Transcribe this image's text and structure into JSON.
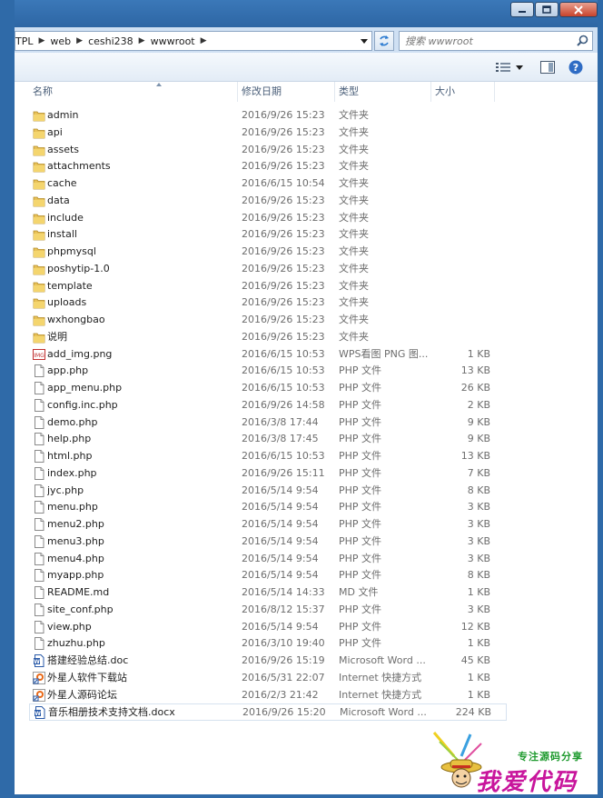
{
  "window": {
    "controls": {
      "minimize": "minimize",
      "maximize": "maximize",
      "close": "close"
    }
  },
  "address": {
    "crumbs": [
      "TPL",
      "web",
      "ceshi238",
      "wwwroot"
    ]
  },
  "search": {
    "placeholder": "搜索 wwwroot"
  },
  "toolbar": {
    "icons": [
      "view-details-icon",
      "view-options-dropdown-icon",
      "preview-pane-icon",
      "help-icon"
    ]
  },
  "columns": {
    "name": "名称",
    "date": "修改日期",
    "type": "类型",
    "size": "大小"
  },
  "files": [
    {
      "icon": "folder",
      "name": "admin",
      "date": "2016/9/26 15:23",
      "type": "文件夹",
      "size": ""
    },
    {
      "icon": "folder",
      "name": "api",
      "date": "2016/9/26 15:23",
      "type": "文件夹",
      "size": ""
    },
    {
      "icon": "folder",
      "name": "assets",
      "date": "2016/9/26 15:23",
      "type": "文件夹",
      "size": ""
    },
    {
      "icon": "folder",
      "name": "attachments",
      "date": "2016/9/26 15:23",
      "type": "文件夹",
      "size": ""
    },
    {
      "icon": "folder",
      "name": "cache",
      "date": "2016/6/15 10:54",
      "type": "文件夹",
      "size": ""
    },
    {
      "icon": "folder",
      "name": "data",
      "date": "2016/9/26 15:23",
      "type": "文件夹",
      "size": ""
    },
    {
      "icon": "folder",
      "name": "include",
      "date": "2016/9/26 15:23",
      "type": "文件夹",
      "size": ""
    },
    {
      "icon": "folder",
      "name": "install",
      "date": "2016/9/26 15:23",
      "type": "文件夹",
      "size": ""
    },
    {
      "icon": "folder",
      "name": "phpmysql",
      "date": "2016/9/26 15:23",
      "type": "文件夹",
      "size": ""
    },
    {
      "icon": "folder",
      "name": "poshytip-1.0",
      "date": "2016/9/26 15:23",
      "type": "文件夹",
      "size": ""
    },
    {
      "icon": "folder",
      "name": "template",
      "date": "2016/9/26 15:23",
      "type": "文件夹",
      "size": ""
    },
    {
      "icon": "folder",
      "name": "uploads",
      "date": "2016/9/26 15:23",
      "type": "文件夹",
      "size": ""
    },
    {
      "icon": "folder",
      "name": "wxhongbao",
      "date": "2016/9/26 15:23",
      "type": "文件夹",
      "size": ""
    },
    {
      "icon": "folder",
      "name": "说明",
      "date": "2016/9/26 15:23",
      "type": "文件夹",
      "size": ""
    },
    {
      "icon": "image",
      "name": "add_img.png",
      "date": "2016/6/15 10:53",
      "type": "WPS看图 PNG 图...",
      "size": "1 KB"
    },
    {
      "icon": "file",
      "name": "app.php",
      "date": "2016/6/15 10:53",
      "type": "PHP 文件",
      "size": "13 KB"
    },
    {
      "icon": "file",
      "name": "app_menu.php",
      "date": "2016/6/15 10:53",
      "type": "PHP 文件",
      "size": "26 KB"
    },
    {
      "icon": "file",
      "name": "config.inc.php",
      "date": "2016/9/26 14:58",
      "type": "PHP 文件",
      "size": "2 KB"
    },
    {
      "icon": "file",
      "name": "demo.php",
      "date": "2016/3/8 17:44",
      "type": "PHP 文件",
      "size": "9 KB"
    },
    {
      "icon": "file",
      "name": "help.php",
      "date": "2016/3/8 17:45",
      "type": "PHP 文件",
      "size": "9 KB"
    },
    {
      "icon": "file",
      "name": "html.php",
      "date": "2016/6/15 10:53",
      "type": "PHP 文件",
      "size": "13 KB"
    },
    {
      "icon": "file",
      "name": "index.php",
      "date": "2016/9/26 15:11",
      "type": "PHP 文件",
      "size": "7 KB"
    },
    {
      "icon": "file",
      "name": "jyc.php",
      "date": "2016/5/14 9:54",
      "type": "PHP 文件",
      "size": "8 KB"
    },
    {
      "icon": "file",
      "name": "menu.php",
      "date": "2016/5/14 9:54",
      "type": "PHP 文件",
      "size": "3 KB"
    },
    {
      "icon": "file",
      "name": "menu2.php",
      "date": "2016/5/14 9:54",
      "type": "PHP 文件",
      "size": "3 KB"
    },
    {
      "icon": "file",
      "name": "menu3.php",
      "date": "2016/5/14 9:54",
      "type": "PHP 文件",
      "size": "3 KB"
    },
    {
      "icon": "file",
      "name": "menu4.php",
      "date": "2016/5/14 9:54",
      "type": "PHP 文件",
      "size": "3 KB"
    },
    {
      "icon": "file",
      "name": "myapp.php",
      "date": "2016/5/14 9:54",
      "type": "PHP 文件",
      "size": "8 KB"
    },
    {
      "icon": "file",
      "name": "README.md",
      "date": "2016/5/14 14:33",
      "type": "MD 文件",
      "size": "1 KB"
    },
    {
      "icon": "file",
      "name": "site_conf.php",
      "date": "2016/8/12 15:37",
      "type": "PHP 文件",
      "size": "3 KB"
    },
    {
      "icon": "file",
      "name": "view.php",
      "date": "2016/5/14 9:54",
      "type": "PHP 文件",
      "size": "12 KB"
    },
    {
      "icon": "file",
      "name": "zhuzhu.php",
      "date": "2016/3/10 19:40",
      "type": "PHP 文件",
      "size": "1 KB"
    },
    {
      "icon": "word",
      "name": "搭建经验总结.doc",
      "date": "2016/9/26 15:19",
      "type": "Microsoft Word ...",
      "size": "45 KB"
    },
    {
      "icon": "shortcut",
      "name": "外星人软件下载站",
      "date": "2016/5/31 22:07",
      "type": "Internet 快捷方式",
      "size": "1 KB"
    },
    {
      "icon": "shortcut",
      "name": "外星人源码论坛",
      "date": "2016/2/3 21:42",
      "type": "Internet 快捷方式",
      "size": "1 KB"
    },
    {
      "icon": "word",
      "name": "音乐相册技术支持文档.docx",
      "date": "2016/9/26 15:20",
      "type": "Microsoft Word ...",
      "size": "224 KB"
    }
  ],
  "selected_index": 35,
  "watermark": {
    "tagline": "专注源码分享",
    "brand": "我爱代码"
  },
  "colors": {
    "frame": "#2f6aa8",
    "folder": "#e8c25a",
    "watermark_green": "#1e9a2e",
    "watermark_pink": "#c8159c"
  }
}
